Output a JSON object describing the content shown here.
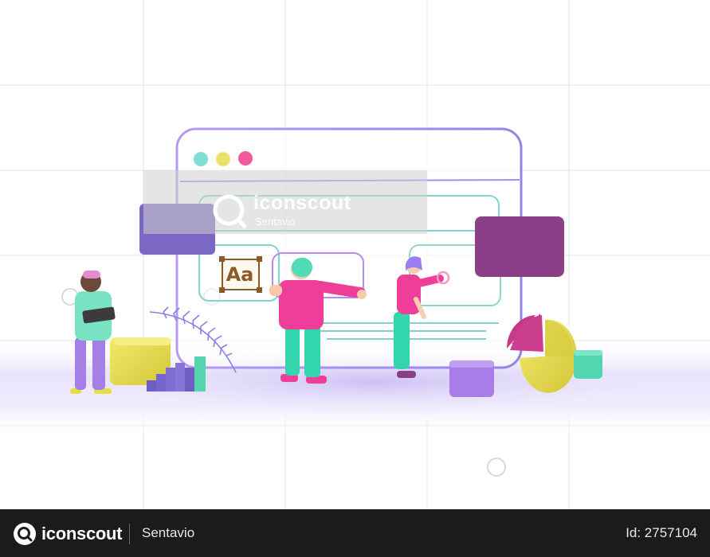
{
  "watermark": {
    "brand": "iconscout",
    "author": "Sentavio"
  },
  "illustration": {
    "type_sample_label": "Aa",
    "window_dot_colors": [
      "#7fe0d8",
      "#e9e36a",
      "#f25c9a"
    ],
    "palette": {
      "frame": "#a78bf0",
      "purple_block": "#7b68c4",
      "plum_block": "#8a3f86",
      "yellow": "#e8de4f",
      "mint": "#52d6b0",
      "pink": "#ef3e9a",
      "violet": "#a77ee8"
    }
  },
  "footer": {
    "brand": "iconscout",
    "author": "Sentavio",
    "asset_id": "Id: 2757104"
  }
}
